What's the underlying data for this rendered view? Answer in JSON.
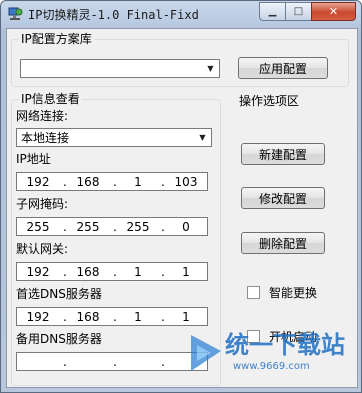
{
  "window": {
    "title": "IP切换精灵-1.0 Final-Fixd",
    "minimize_glyph": "▁",
    "maximize_glyph": "□",
    "close_glyph": "✕"
  },
  "ip_profile_group": {
    "label": "IP配置方案库",
    "profile_select_value": "",
    "apply_button": "应用配置"
  },
  "ip_info_group": {
    "label": "IP信息查看",
    "network_connection_label": "网络连接:",
    "network_connection_value": "本地连接",
    "ip_address_label": "IP地址",
    "ip_address": [
      "192",
      "168",
      "1",
      "103"
    ],
    "subnet_mask_label": "子网掩码:",
    "subnet_mask": [
      "255",
      "255",
      "255",
      "0"
    ],
    "gateway_label": "默认网关:",
    "gateway": [
      "192",
      "168",
      "1",
      "1"
    ],
    "preferred_dns_label": "首选DNS服务器",
    "preferred_dns": [
      "192",
      "168",
      "1",
      "1"
    ],
    "alternate_dns_label": "备用DNS服务器",
    "alternate_dns": [
      "",
      "",
      "",
      ""
    ]
  },
  "options_group": {
    "label": "操作选项区",
    "new_config_button": "新建配置",
    "modify_config_button": "修改配置",
    "delete_config_button": "删除配置",
    "smart_switch_label": "智能更换",
    "smart_switch_checked": false,
    "startup_label": "开机启动",
    "startup_checked": false
  },
  "watermark": {
    "name": "统一下载站",
    "url": "www.9669.com"
  }
}
